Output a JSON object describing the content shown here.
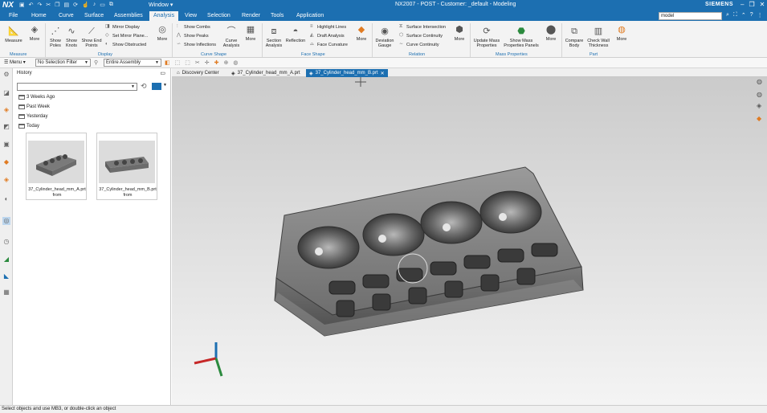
{
  "titlebar": {
    "logo": "NX",
    "window_menu": "Window ▾",
    "title": "NX2007 - POST - Customer: _default - Modeling",
    "brand": "SIEMENS",
    "controls": [
      "–",
      "❐",
      "✕"
    ]
  },
  "menubar": {
    "items": [
      "File",
      "Home",
      "Curve",
      "Surface",
      "Assemblies",
      "Analysis",
      "View",
      "Selection",
      "Render",
      "Tools",
      "Application"
    ],
    "active": "Analysis",
    "search_value": "model"
  },
  "ribbon": {
    "groups": [
      "Measure",
      "Display",
      "Curve Shape",
      "Face Shape",
      "Relation",
      "Mass Properties",
      "Part"
    ],
    "measure": "Measure",
    "more": "More",
    "show_poles": "Show Poles",
    "show_knots": "Show Knots",
    "show_end_points": "Show End Points",
    "mirror_display": "Mirror Display",
    "set_mirror_plane": "Set Mirror Plane...",
    "show_obstructed": "Show Obstructed",
    "show_combs": "Show Combs",
    "show_peaks": "Show Peaks",
    "show_inflections": "Show Inflections",
    "curve_analysis": "Curve Analysis",
    "section_analysis": "Section Analysis",
    "reflection": "Reflection",
    "highlight_lines": "Highlight Lines",
    "draft_analysis": "Draft Analysis",
    "face_curvature": "Face Curvature",
    "deviation_gauge": "Deviation Gauge",
    "surface_intersection": "Surface Intersection",
    "surface_continuity": "Surface Continuity",
    "curve_continuity": "Curve Continuity",
    "update_mass_properties": "Update Mass Properties",
    "show_mass_properties_panels": "Show Mass Properties Panels",
    "compare_body": "Compare Body",
    "check_wall_thickness": "Check Wall Thickness"
  },
  "selbar": {
    "menu": "☰ Menu ▾",
    "filter": "No Selection Filter",
    "scope": "Entire Assembly"
  },
  "history": {
    "title": "History",
    "folders": [
      "3 Weeks Ago",
      "Past Week",
      "Yesterday",
      "Today"
    ],
    "files": [
      {
        "name": "37_Cylinder_head_mm_A.prt",
        "sub": "from"
      },
      {
        "name": "37_Cylinder_head_mm_B.prt",
        "sub": "from"
      }
    ]
  },
  "tabs": [
    "Discovery Center",
    "37_Cylinder_head_mm_A.prt",
    "37_Cylinder_head_mm_B.prt"
  ],
  "status": "Select objects and use MB3, or double-click an object",
  "colors": {
    "accent": "#1c6fb1",
    "model": "#7d7d7d"
  }
}
